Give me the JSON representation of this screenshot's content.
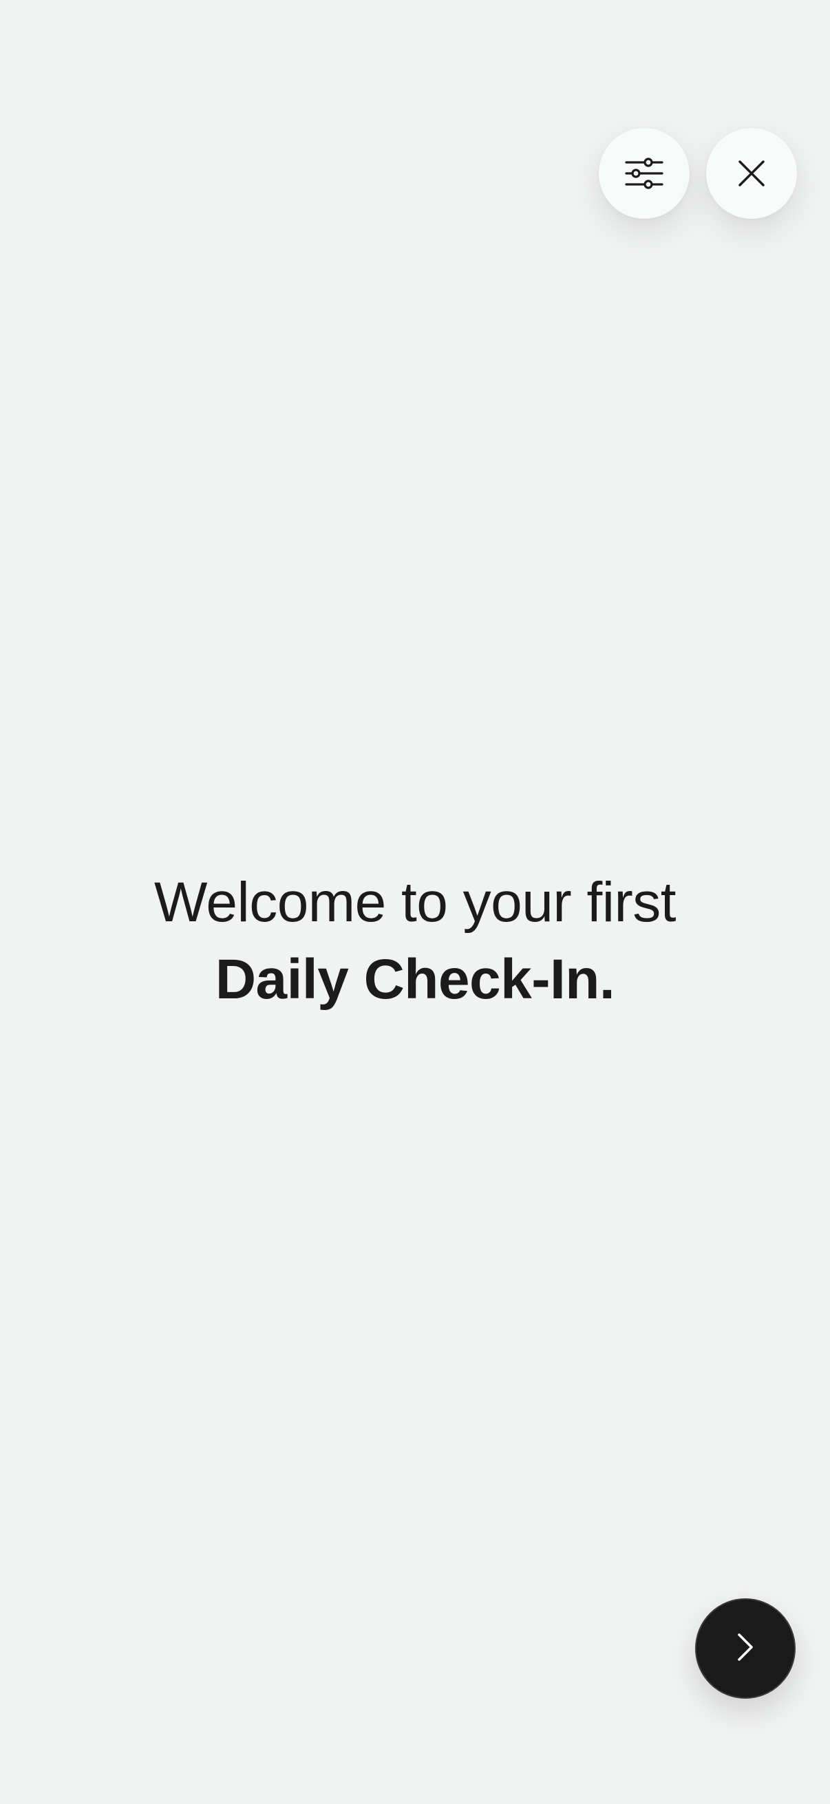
{
  "header": {
    "filter_icon": "sliders-icon",
    "close_icon": "close-icon"
  },
  "welcome": {
    "line1": "Welcome to your first",
    "line2": "Daily Check-In."
  },
  "footer": {
    "next_icon": "chevron-right-icon"
  },
  "colors": {
    "background": "#f1f2f2",
    "text": "#1b1b1b",
    "button_light": "#f9fafa",
    "button_dark": "#1a1a1a"
  }
}
